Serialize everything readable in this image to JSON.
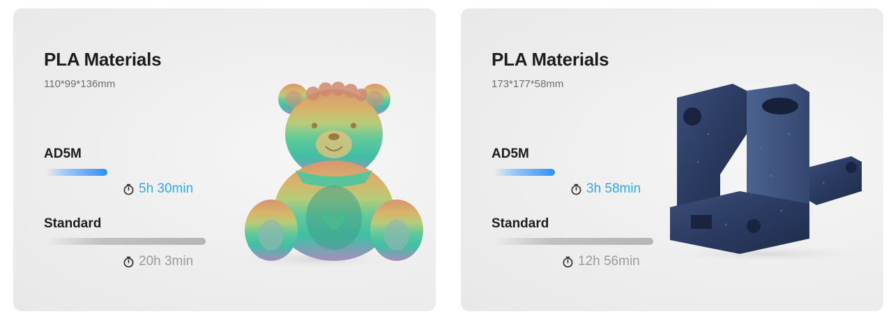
{
  "cards": [
    {
      "material": "PLA Materials",
      "dimensions": "110*99*136mm",
      "fast_printer": "AD5M",
      "fast_time": "5h 30min",
      "fast_progress": 0.39,
      "standard_label": "Standard",
      "standard_time": "20h 3min",
      "standard_progress": 1.0,
      "image_icon": "rainbow-bear-model"
    },
    {
      "material": "PLA Materials",
      "dimensions": "173*177*58mm",
      "fast_printer": "AD5M",
      "fast_time": "3h 58min",
      "fast_progress": 0.39,
      "standard_label": "Standard",
      "standard_time": "12h 56min",
      "standard_progress": 1.0,
      "image_icon": "blue-mechanical-part-model"
    }
  ],
  "colors": {
    "accent_blue": "#35a7f2",
    "muted_gray": "#9b9b9b",
    "title_dark": "#1c1c1c"
  }
}
